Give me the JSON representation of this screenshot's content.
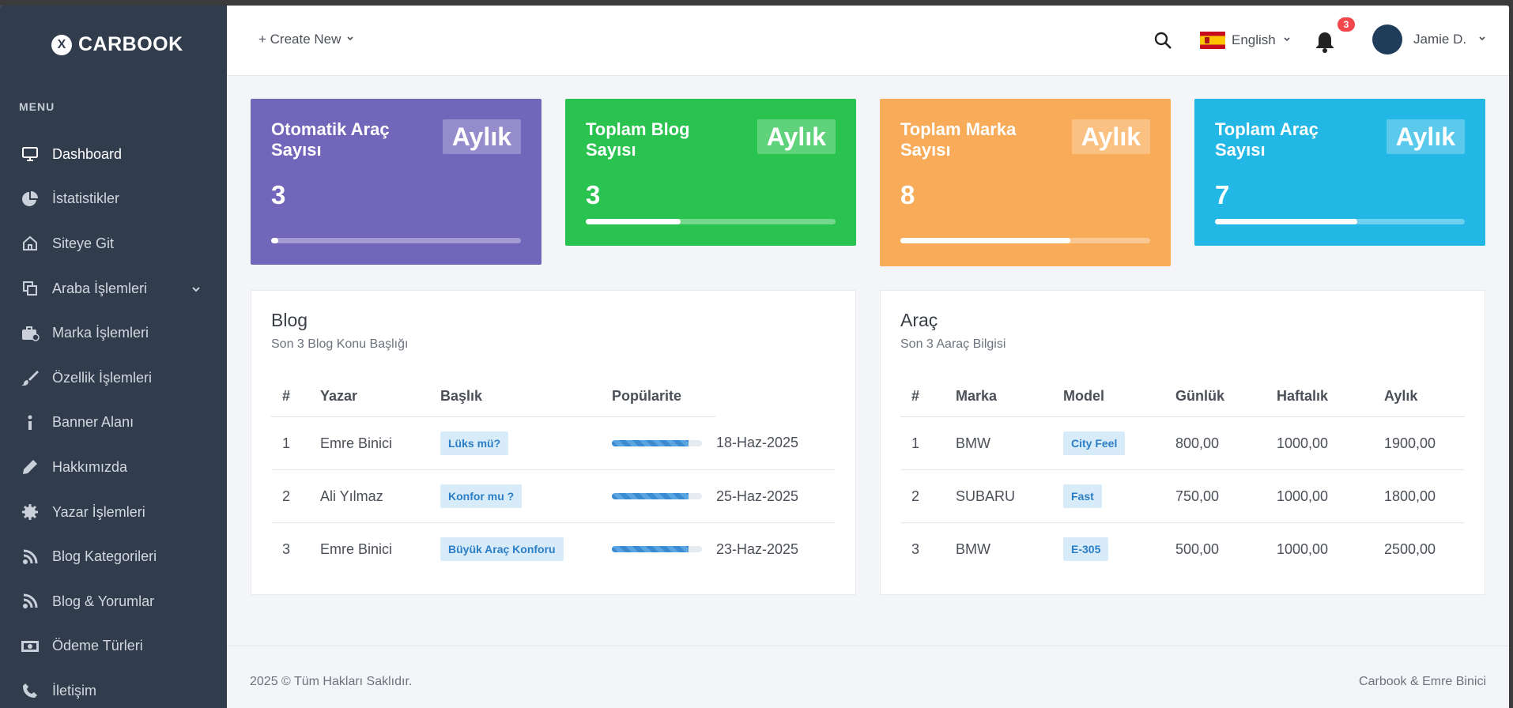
{
  "brand": {
    "logo_glyph": "X",
    "name": "CARBOOK"
  },
  "sidebar": {
    "menu_title": "MENU",
    "items": [
      {
        "label": "Dashboard",
        "icon": "monitor-icon"
      },
      {
        "label": "İstatistikler",
        "icon": "pie-chart-icon"
      },
      {
        "label": "Siteye Git",
        "icon": "home-icon"
      },
      {
        "label": "Araba İşlemleri",
        "icon": "copy-icon"
      },
      {
        "label": "Marka İşlemleri",
        "icon": "briefcase-icon"
      },
      {
        "label": "Özellik İşlemleri",
        "icon": "brush-icon"
      },
      {
        "label": "Banner Alanı",
        "icon": "info-icon"
      },
      {
        "label": "Hakkımızda",
        "icon": "pencil-icon"
      },
      {
        "label": "Yazar İşlemleri",
        "icon": "gear-icon"
      },
      {
        "label": "Blog Kategorileri",
        "icon": "rss-icon"
      },
      {
        "label": "Blog & Yorumlar",
        "icon": "rss-icon"
      },
      {
        "label": "Ödeme Türleri",
        "icon": "money-icon"
      },
      {
        "label": "İletişim",
        "icon": "phone-icon"
      }
    ]
  },
  "topbar": {
    "create_new": "+ Create New",
    "language": "English",
    "notifications_count": "3",
    "user_name": "Jamie D."
  },
  "stats": [
    {
      "title": "Otomatik Araç Sayısı",
      "badge": "Aylık",
      "value": "3",
      "progress": 0.03,
      "color": "#7266ba"
    },
    {
      "title": "Toplam Blog Sayısı",
      "badge": "Aylık",
      "value": "3",
      "progress": 0.38,
      "color": "#2ac34f"
    },
    {
      "title": "Toplam Marka Sayısı",
      "badge": "Aylık",
      "value": "8",
      "progress": 0.68,
      "color": "#f8ac59"
    },
    {
      "title": "Toplam Araç Sayısı",
      "badge": "Aylık",
      "value": "7",
      "progress": 0.57,
      "color": "#23b7e5"
    }
  ],
  "blog_panel": {
    "title": "Blog",
    "subtitle": "Son 3 Blog Konu Başlığı",
    "headers": [
      "#",
      "Yazar",
      "Başlık",
      "Popülarite"
    ],
    "rows": [
      {
        "num": "1",
        "author": "Emre Binici",
        "title": "Lüks mü?",
        "popularity": 0.85,
        "date": "18-Haz-2025"
      },
      {
        "num": "2",
        "author": "Ali Yılmaz",
        "title": "Konfor mu ?",
        "popularity": 0.85,
        "date": "25-Haz-2025"
      },
      {
        "num": "3",
        "author": "Emre Binici",
        "title": "Büyük Araç Konforu",
        "popularity": 0.85,
        "date": "23-Haz-2025"
      }
    ]
  },
  "car_panel": {
    "title": "Araç",
    "subtitle": "Son 3 Aaraç Bilgisi",
    "headers": [
      "#",
      "Marka",
      "Model",
      "Günlük",
      "Haftalık",
      "Aylık"
    ],
    "rows": [
      {
        "num": "1",
        "brand": "BMW",
        "model": "City Feel",
        "daily": "800,00",
        "weekly": "1000,00",
        "monthly": "1900,00"
      },
      {
        "num": "2",
        "brand": "SUBARU",
        "model": "Fast",
        "daily": "750,00",
        "weekly": "1000,00",
        "monthly": "1800,00"
      },
      {
        "num": "3",
        "brand": "BMW",
        "model": "E-305",
        "daily": "500,00",
        "weekly": "1000,00",
        "monthly": "2500,00"
      }
    ]
  },
  "footer": {
    "left": "2025 © Tüm Hakları Saklıdır.",
    "right": "Carbook & Emre Binici"
  }
}
